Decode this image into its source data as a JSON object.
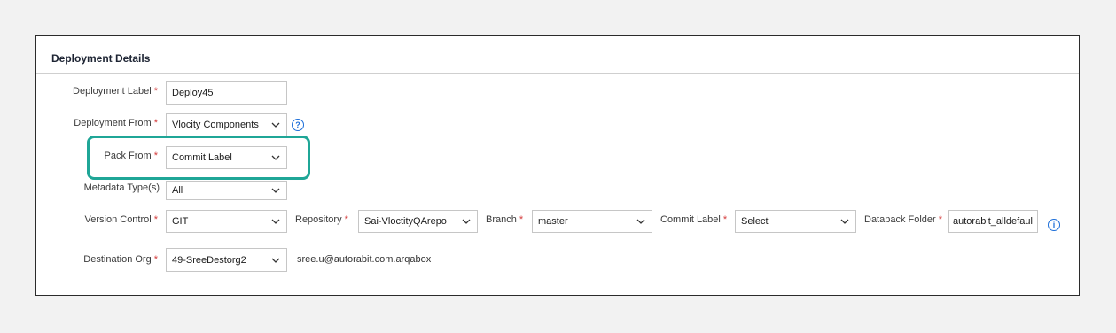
{
  "section": {
    "title": "Deployment Details"
  },
  "colors": {
    "required": "#d43a3a",
    "highlight": "#1fa697",
    "info_blue": "#1e6fd9"
  },
  "form": {
    "deployment_label": {
      "label": "Deployment Label",
      "value": "Deploy45"
    },
    "deployment_from": {
      "label": "Deployment From",
      "value": "Vlocity Components",
      "help_icon": "question-circle-icon"
    },
    "pack_from": {
      "label": "Pack From",
      "value": "Commit Label"
    },
    "metadata_types": {
      "label": "Metadata Type(s)",
      "value": "All"
    },
    "version_control": {
      "label": "Version Control",
      "value": "GIT"
    },
    "repository": {
      "label": "Repository",
      "value": "Sai-VloctityQArepo"
    },
    "branch": {
      "label": "Branch",
      "value": "master"
    },
    "commit_label": {
      "label": "Commit Label",
      "value": "Select"
    },
    "datapack_folder": {
      "label": "Datapack Folder",
      "value": "autorabit_alldefaul",
      "info_icon": "info-circle-icon"
    },
    "destination_org": {
      "label": "Destination Org",
      "value": "49-SreeDestorg2",
      "account": "sree.u@autorabit.com.arqabox"
    }
  }
}
